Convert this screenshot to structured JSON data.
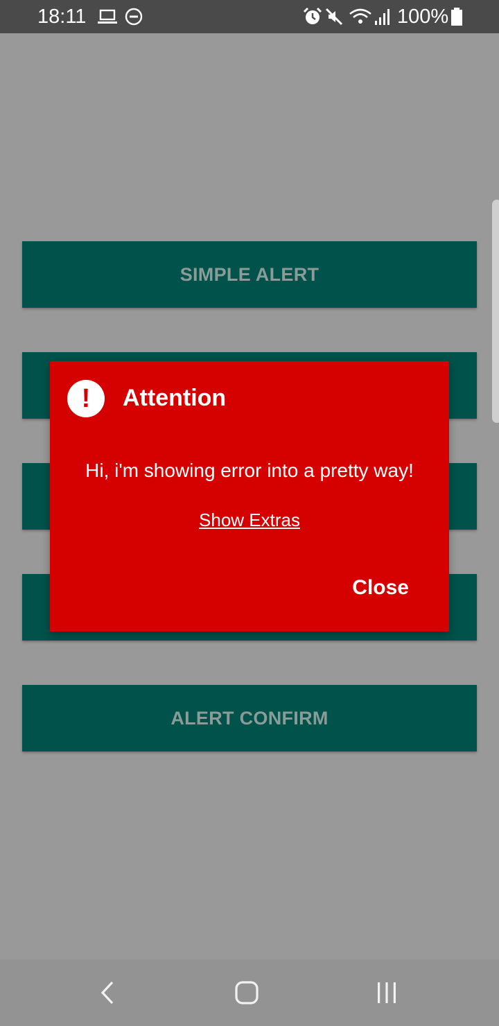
{
  "status_bar": {
    "time": "18:11",
    "battery_percent": "100%",
    "icons": [
      "laptop-icon",
      "dnd-icon",
      "alarm-icon",
      "mute-icon",
      "wifi-icon",
      "signal-icon",
      "battery-icon"
    ]
  },
  "buttons": [
    {
      "label": "SIMPLE ALERT"
    },
    {
      "label": ""
    },
    {
      "label": ""
    },
    {
      "label": ""
    },
    {
      "label": "ALERT CONFIRM"
    }
  ],
  "dialog": {
    "icon": "exclamation-icon",
    "icon_glyph": "!",
    "title": "Attention",
    "message": "Hi, i'm showing error into a pretty way!",
    "link": "Show Extras",
    "close_label": "Close"
  },
  "nav_bar": {
    "icons": [
      "back-icon",
      "home-icon",
      "recents-icon"
    ]
  },
  "colors": {
    "status_bar": "#4a4a4a",
    "scrim": "#999999",
    "button": "#00524a",
    "dialog": "#d50000"
  }
}
